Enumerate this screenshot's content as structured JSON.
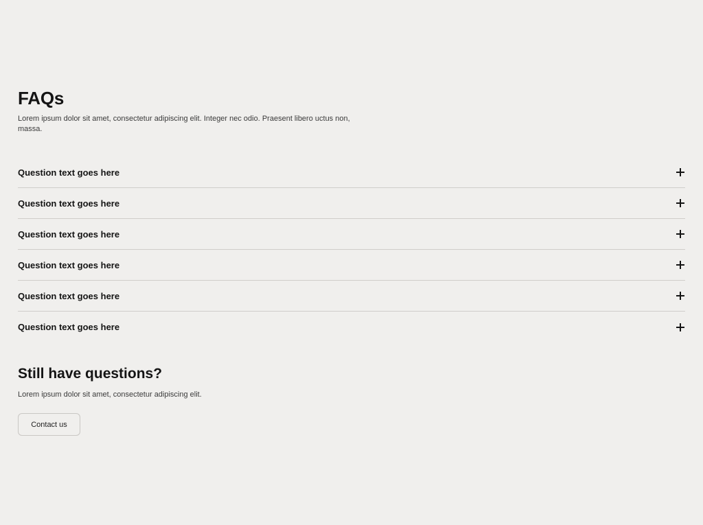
{
  "faq": {
    "title": "FAQs",
    "intro": "Lorem ipsum dolor sit amet, consectetur adipiscing elit. Integer nec odio. Praesent libero uctus non, massa.",
    "items": [
      {
        "question": "Question text goes here",
        "icon": "plus-icon"
      },
      {
        "question": "Question text goes here",
        "icon": "plus-icon"
      },
      {
        "question": "Question text goes here",
        "icon": "plus-icon"
      },
      {
        "question": "Question text goes here",
        "icon": "plus-icon"
      },
      {
        "question": "Question text goes here",
        "icon": "plus-icon"
      },
      {
        "question": "Question text goes here",
        "icon": "plus-icon"
      }
    ]
  },
  "cta": {
    "title": "Still have questions?",
    "text": "Lorem ipsum dolor sit amet, consectetur adipiscing elit.",
    "button_label": "Contact us"
  },
  "colors": {
    "background": "#f0efed",
    "text": "#141414",
    "divider": "#cfcdca"
  }
}
